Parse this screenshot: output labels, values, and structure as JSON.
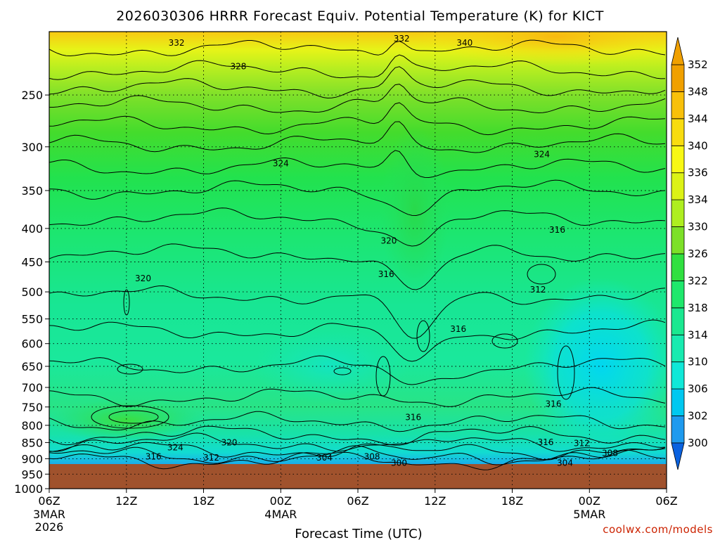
{
  "chart_data": {
    "type": "heatmap",
    "title": "2026030306 HRRR Forecast Equiv. Potential Temperature (K) for KICT",
    "xlabel": "Forecast Time (UTC)",
    "ylabel": "",
    "x_ticks": [
      "06Z",
      "12Z",
      "18Z",
      "00Z",
      "06Z",
      "12Z",
      "18Z",
      "00Z",
      "06Z"
    ],
    "x_hours": [
      0,
      6,
      12,
      18,
      24,
      30,
      36,
      42,
      48
    ],
    "x_date_labels": [
      {
        "hour": 0,
        "lines": [
          "3MAR",
          "2026"
        ]
      },
      {
        "hour": 18,
        "lines": [
          "4MAR"
        ]
      },
      {
        "hour": 42,
        "lines": [
          "5MAR"
        ]
      }
    ],
    "y_ticks": [
      250,
      300,
      350,
      400,
      450,
      500,
      550,
      600,
      650,
      700,
      750,
      800,
      850,
      900,
      950,
      1000
    ],
    "ylim": [
      200,
      1000
    ],
    "y_scale": "log-pressure (inverted)",
    "grid": true,
    "colorbar_levels": [
      300,
      302,
      306,
      310,
      314,
      318,
      322,
      326,
      330,
      334,
      336,
      340,
      344,
      348,
      352
    ],
    "colorbar_colors": [
      "#0a62e0",
      "#1e9aee",
      "#00c8f0",
      "#10e8d8",
      "#18ebb0",
      "#1ae890",
      "#1ee86c",
      "#30e040",
      "#7ce028",
      "#aeee20",
      "#dcf216",
      "#f8f814",
      "#f8dc10",
      "#f8c00a",
      "#f0a000"
    ],
    "contour_labels": [
      {
        "hour": 9.9,
        "p": 208,
        "text": "332"
      },
      {
        "hour": 27.4,
        "p": 205,
        "text": "332"
      },
      {
        "hour": 32.3,
        "p": 208,
        "text": "340"
      },
      {
        "hour": 14.7,
        "p": 226,
        "text": "328"
      },
      {
        "hour": 18.0,
        "p": 318,
        "text": "324"
      },
      {
        "hour": 38.3,
        "p": 308,
        "text": "324"
      },
      {
        "hour": 26.4,
        "p": 418,
        "text": "320"
      },
      {
        "hour": 7.3,
        "p": 477,
        "text": "320"
      },
      {
        "hour": 39.5,
        "p": 402,
        "text": "316"
      },
      {
        "hour": 26.2,
        "p": 470,
        "text": "316"
      },
      {
        "hour": 38.0,
        "p": 496,
        "text": "312"
      },
      {
        "hour": 31.8,
        "p": 570,
        "text": "316"
      },
      {
        "hour": 39.2,
        "p": 742,
        "text": "316"
      },
      {
        "hour": 28.3,
        "p": 778,
        "text": "316"
      },
      {
        "hour": 9.8,
        "p": 865,
        "text": "324"
      },
      {
        "hour": 14.0,
        "p": 850,
        "text": "320"
      },
      {
        "hour": 8.1,
        "p": 893,
        "text": "316"
      },
      {
        "hour": 12.6,
        "p": 897,
        "text": "312"
      },
      {
        "hour": 21.4,
        "p": 897,
        "text": "304"
      },
      {
        "hour": 25.1,
        "p": 893,
        "text": "308"
      },
      {
        "hour": 27.2,
        "p": 914,
        "text": "300"
      },
      {
        "hour": 38.6,
        "p": 849,
        "text": "316"
      },
      {
        "hour": 41.4,
        "p": 852,
        "text": "312"
      },
      {
        "hour": 43.6,
        "p": 882,
        "text": "308"
      },
      {
        "hour": 40.1,
        "p": 914,
        "text": "304"
      }
    ]
  },
  "footer": {
    "credit": "coolwx.com/models"
  }
}
